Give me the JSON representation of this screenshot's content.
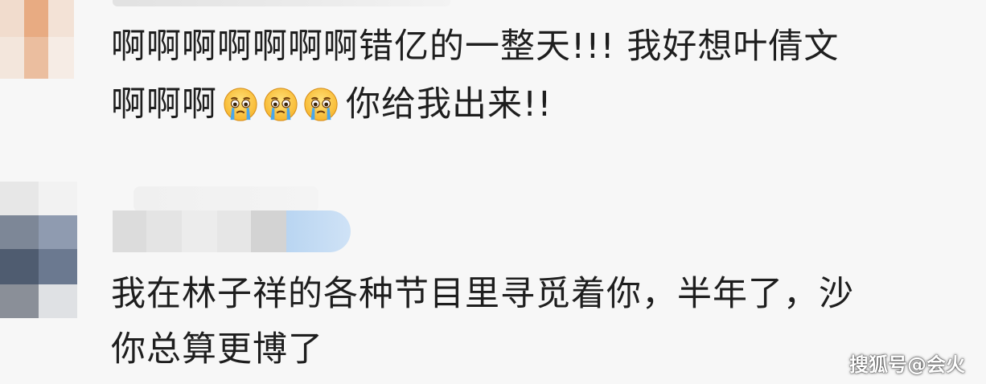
{
  "comments": [
    {
      "line1": "啊啊啊啊啊啊啊错亿的一整天!!!  我好想叶倩文",
      "line2_prefix": "啊啊啊",
      "emoji_names": [
        "crying-face-icon",
        "crying-face-icon",
        "crying-face-icon"
      ],
      "line2_suffix": "你给我出来!!"
    },
    {
      "line1": "我在林子祥的各种节目里寻觅着你，半年了，沙",
      "line2": "你总算更博了"
    }
  ],
  "watermark": "搜狐号@会火",
  "colors": {
    "background": "#f7f7f7",
    "text": "#1e1e1e",
    "avatar1": "#e9b692",
    "avatar2": "#5c6b7f",
    "name_blur_accent": "#bcd7f2"
  }
}
